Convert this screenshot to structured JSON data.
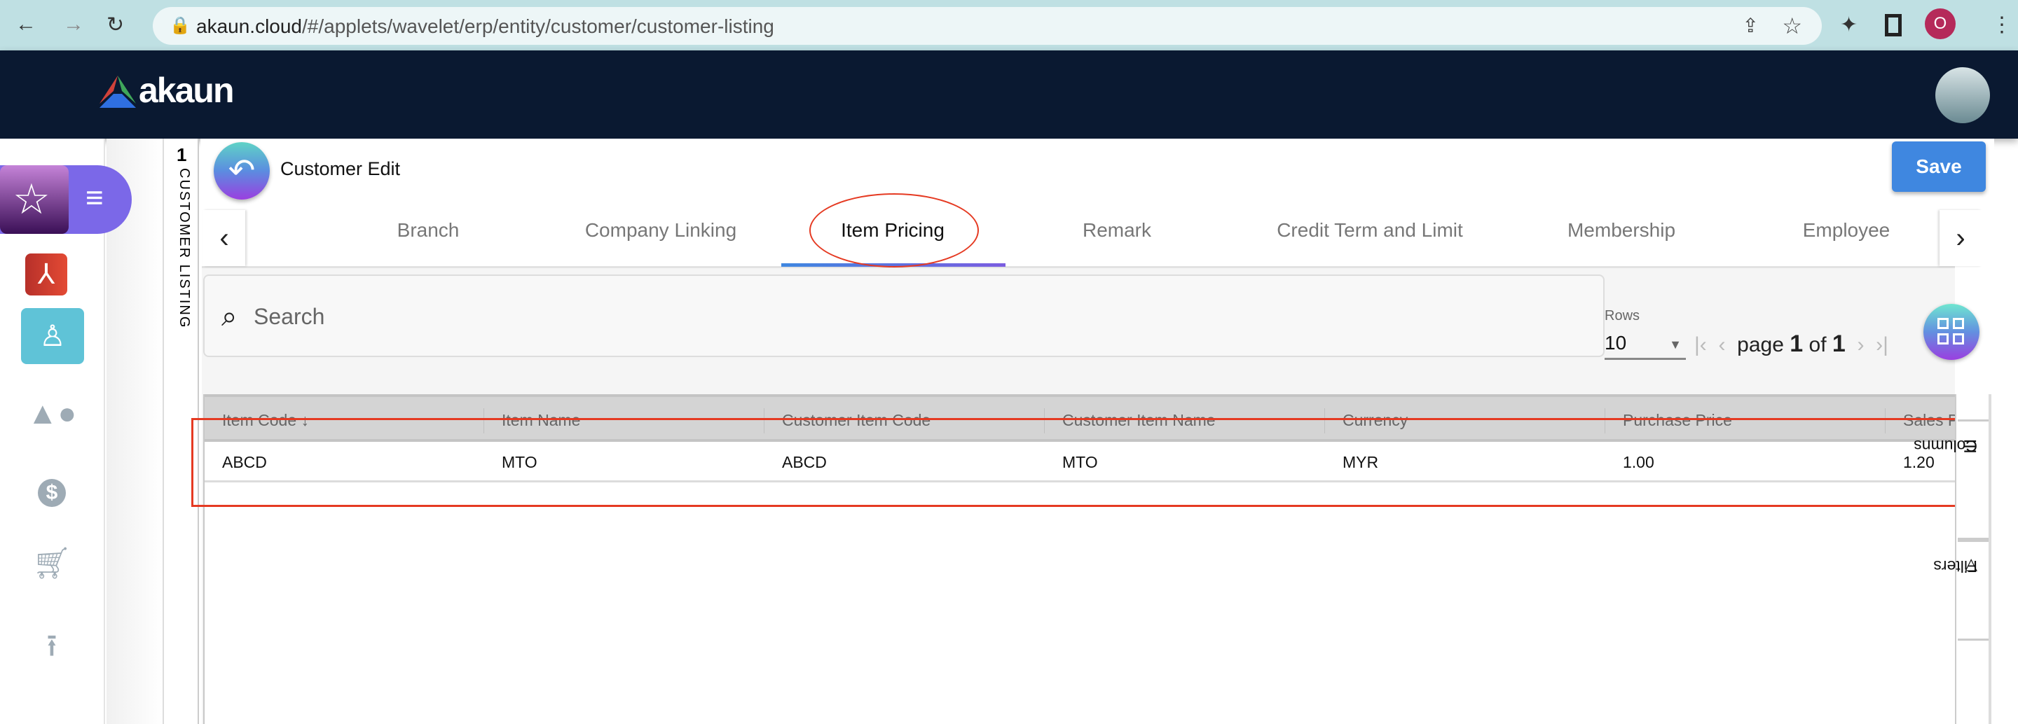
{
  "browser": {
    "url_host": "akaun.cloud",
    "url_path": "/#/applets/wavelet/erp/entity/customer/customer-listing",
    "profile_initial": "O"
  },
  "app": {
    "logo": "akaun"
  },
  "sidebar": {
    "items": [
      "customer-applet",
      "acrobat-app",
      "customers",
      "products",
      "pricing",
      "purchase",
      "upload"
    ]
  },
  "vertical_tab": {
    "number": "1",
    "label": "CUSTOMER LISTING"
  },
  "page": {
    "title": "Customer Edit",
    "save_label": "Save"
  },
  "tabs": [
    {
      "label": "Branch"
    },
    {
      "label": "Company Linking"
    },
    {
      "label": "Item Pricing",
      "active": true
    },
    {
      "label": "Remark"
    },
    {
      "label": "Credit Term and Limit"
    },
    {
      "label": "Membership"
    },
    {
      "label": "Employee"
    }
  ],
  "search": {
    "placeholder": "Search"
  },
  "pagination": {
    "rows_label": "Rows",
    "rows_value": "10",
    "page_word": "page",
    "current": "1",
    "of_word": "of",
    "total": "1"
  },
  "table": {
    "headers": [
      "Item Code",
      "Item Name",
      "Customer Item Code",
      "Customer Item Name",
      "Currency",
      "Purchase Price",
      "Sales P"
    ],
    "sort_indicator": "↓",
    "rows": [
      [
        "ABCD",
        "MTO",
        "ABCD",
        "MTO",
        "MYR",
        "1.00",
        "1.20"
      ]
    ]
  },
  "side_panel": {
    "columns": "Columns",
    "filters": "Filters"
  },
  "colors": {
    "appbar": "#0a1931",
    "accent": "#3f87e0",
    "highlight": "#e53a22",
    "active_nav": "#5fc3d7"
  }
}
